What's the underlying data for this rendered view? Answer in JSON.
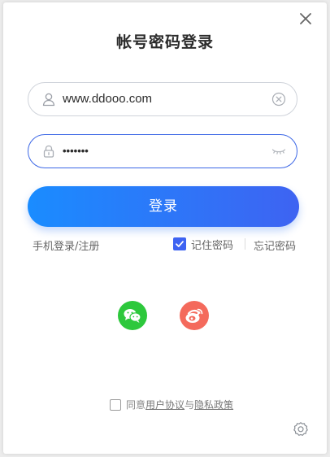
{
  "dialog": {
    "title": "帐号密码登录",
    "close_icon": "close-icon"
  },
  "username": {
    "value": "www.ddooo.com",
    "lead_icon": "user-icon",
    "trail_icon": "clear-icon"
  },
  "password": {
    "value": "•••••••",
    "lead_icon": "lock-icon",
    "trail_icon": "eye-closed-icon"
  },
  "login_button": {
    "label": "登录"
  },
  "links": {
    "phone_login": "手机登录/注册",
    "remember_password": "记住密码",
    "remember_checked": true,
    "forgot_password": "忘记密码"
  },
  "social": {
    "wechat_icon": "wechat-icon",
    "weibo_icon": "weibo-icon"
  },
  "agreement": {
    "checked": false,
    "prefix": "同意",
    "user_agreement": "用户协议",
    "connector": "与",
    "privacy_policy": "隐私政策"
  },
  "settings_icon": "settings-icon",
  "colors": {
    "accent": "#3e63f2",
    "gradient_start": "#1a8cff",
    "wechat": "#2dc83c",
    "weibo": "#f46a5c"
  }
}
